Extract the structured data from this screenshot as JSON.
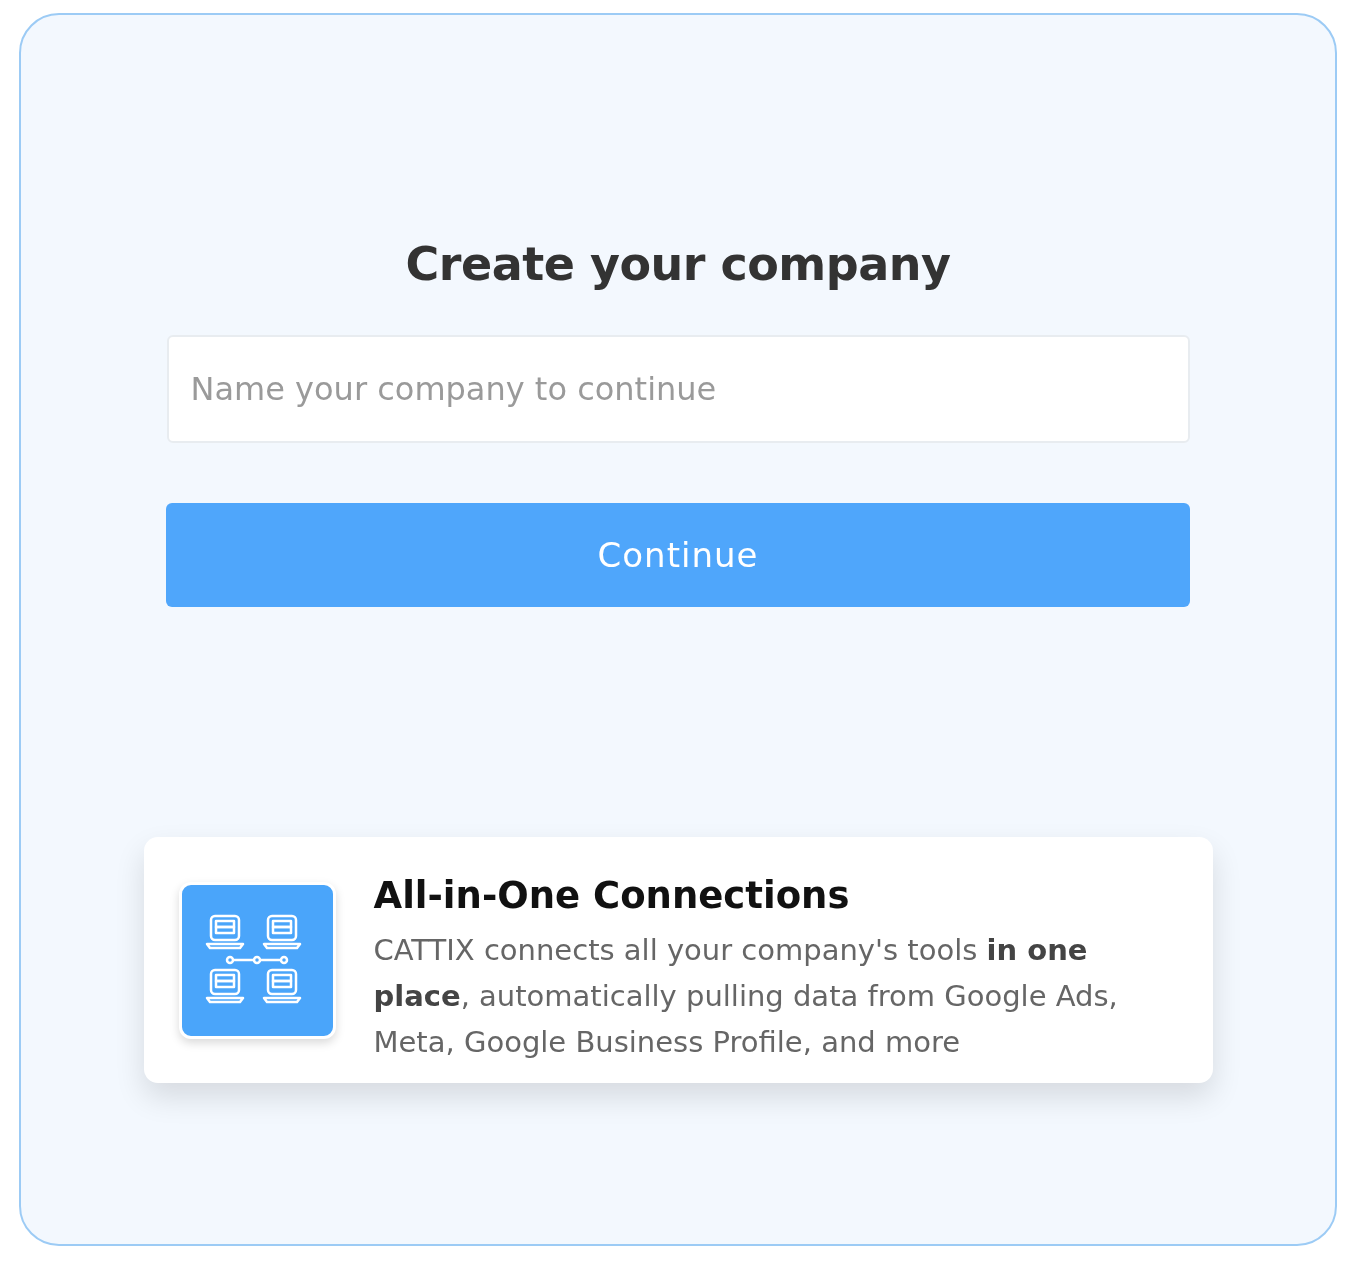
{
  "title": "Create your company",
  "company_field": {
    "placeholder": "Name your company to continue"
  },
  "continue_button": {
    "label": "Continue"
  },
  "feature_card": {
    "title": "All-in-One Connections",
    "text": "CATTIX connects all your company's tools **in one place**, automatically pulling data from Google Ads, Meta, Google Business Profile, and more"
  }
}
